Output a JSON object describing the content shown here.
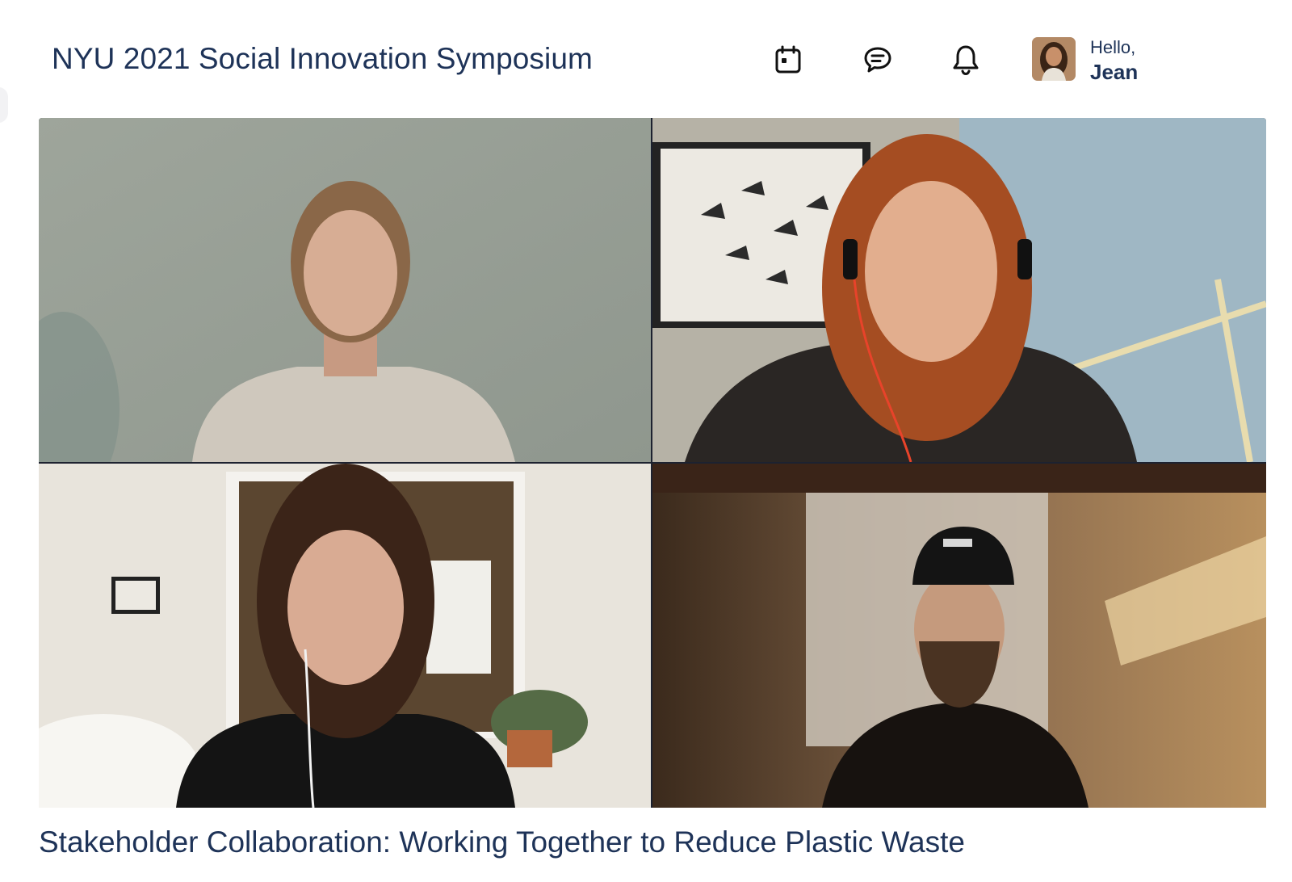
{
  "header": {
    "title": "NYU 2021 Social Innovation Symposium",
    "icons": {
      "calendar": "calendar-icon",
      "chat": "chat-bubble-icon",
      "notifications": "bell-icon"
    },
    "user": {
      "greeting": "Hello,",
      "name": "Jean"
    }
  },
  "video_grid": {
    "tiles": [
      {
        "position": "top-left"
      },
      {
        "position": "top-right"
      },
      {
        "position": "bottom-left"
      },
      {
        "position": "bottom-right"
      }
    ]
  },
  "session": {
    "title": "Stakeholder Collaboration: Working Together to Reduce Plastic Waste"
  },
  "colors": {
    "text": "#1e3358",
    "background": "#ffffff"
  }
}
